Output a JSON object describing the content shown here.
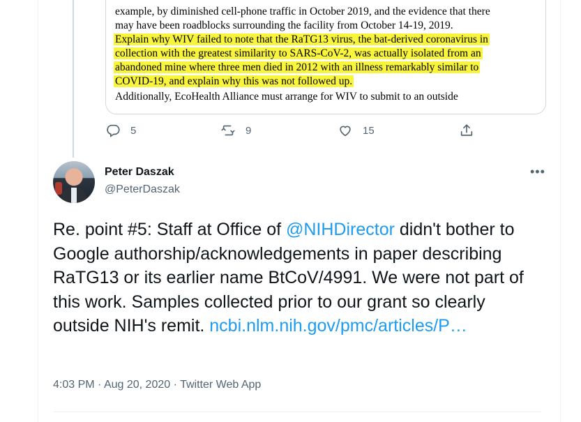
{
  "quoted": {
    "lines": [
      "example, by diminished cell-phone traffic in October 2019, and the evidence that there",
      "may have been roadblocks surrounding the facility from October 14-19, 2019.",
      "Explain why WIV failed to note that the RaTG13 virus, the bat-derived coronavirus in",
      "collection with the greatest similarity to SARS-CoV-2, was actually isolated from an",
      "abandoned mine where three men died in 2012 with an illness remarkably similar to",
      "COVID-19, and explain why this was not followed up.",
      "Additionally, EcoHealth Alliance must arrange for WIV to submit to an outside"
    ],
    "highlight_color": "#f9f53c"
  },
  "parent_actions": {
    "reply_count": "5",
    "retweet_count": "9",
    "like_count": "15"
  },
  "author": {
    "name": "Peter Daszak",
    "handle": "@PeterDaszak"
  },
  "more_label": "•••",
  "tweet": {
    "text_part1": "Re. point #5: Staff at Office of ",
    "mention": "@NIHDirector",
    "text_part2": " didn't bother to Google authorship/acknowledgements in paper describing RaTG13 or its earlier name BtCoV/4991. We were not part of this work. Samples collected prior to our grant so clearly outside NIH's remit. ",
    "link": "ncbi.nlm.nih.gov/pmc/articles/P…"
  },
  "meta": {
    "time": "4:03 PM",
    "date": "Aug 20, 2020",
    "source": "Twitter Web App",
    "separator": " · "
  },
  "icons": {
    "reply": "reply-icon",
    "retweet": "retweet-icon",
    "like": "heart-icon",
    "share": "share-icon",
    "more": "more-icon"
  },
  "colors": {
    "link": "#1d9bf0",
    "secondary": "#536471",
    "text": "#0f1419"
  }
}
